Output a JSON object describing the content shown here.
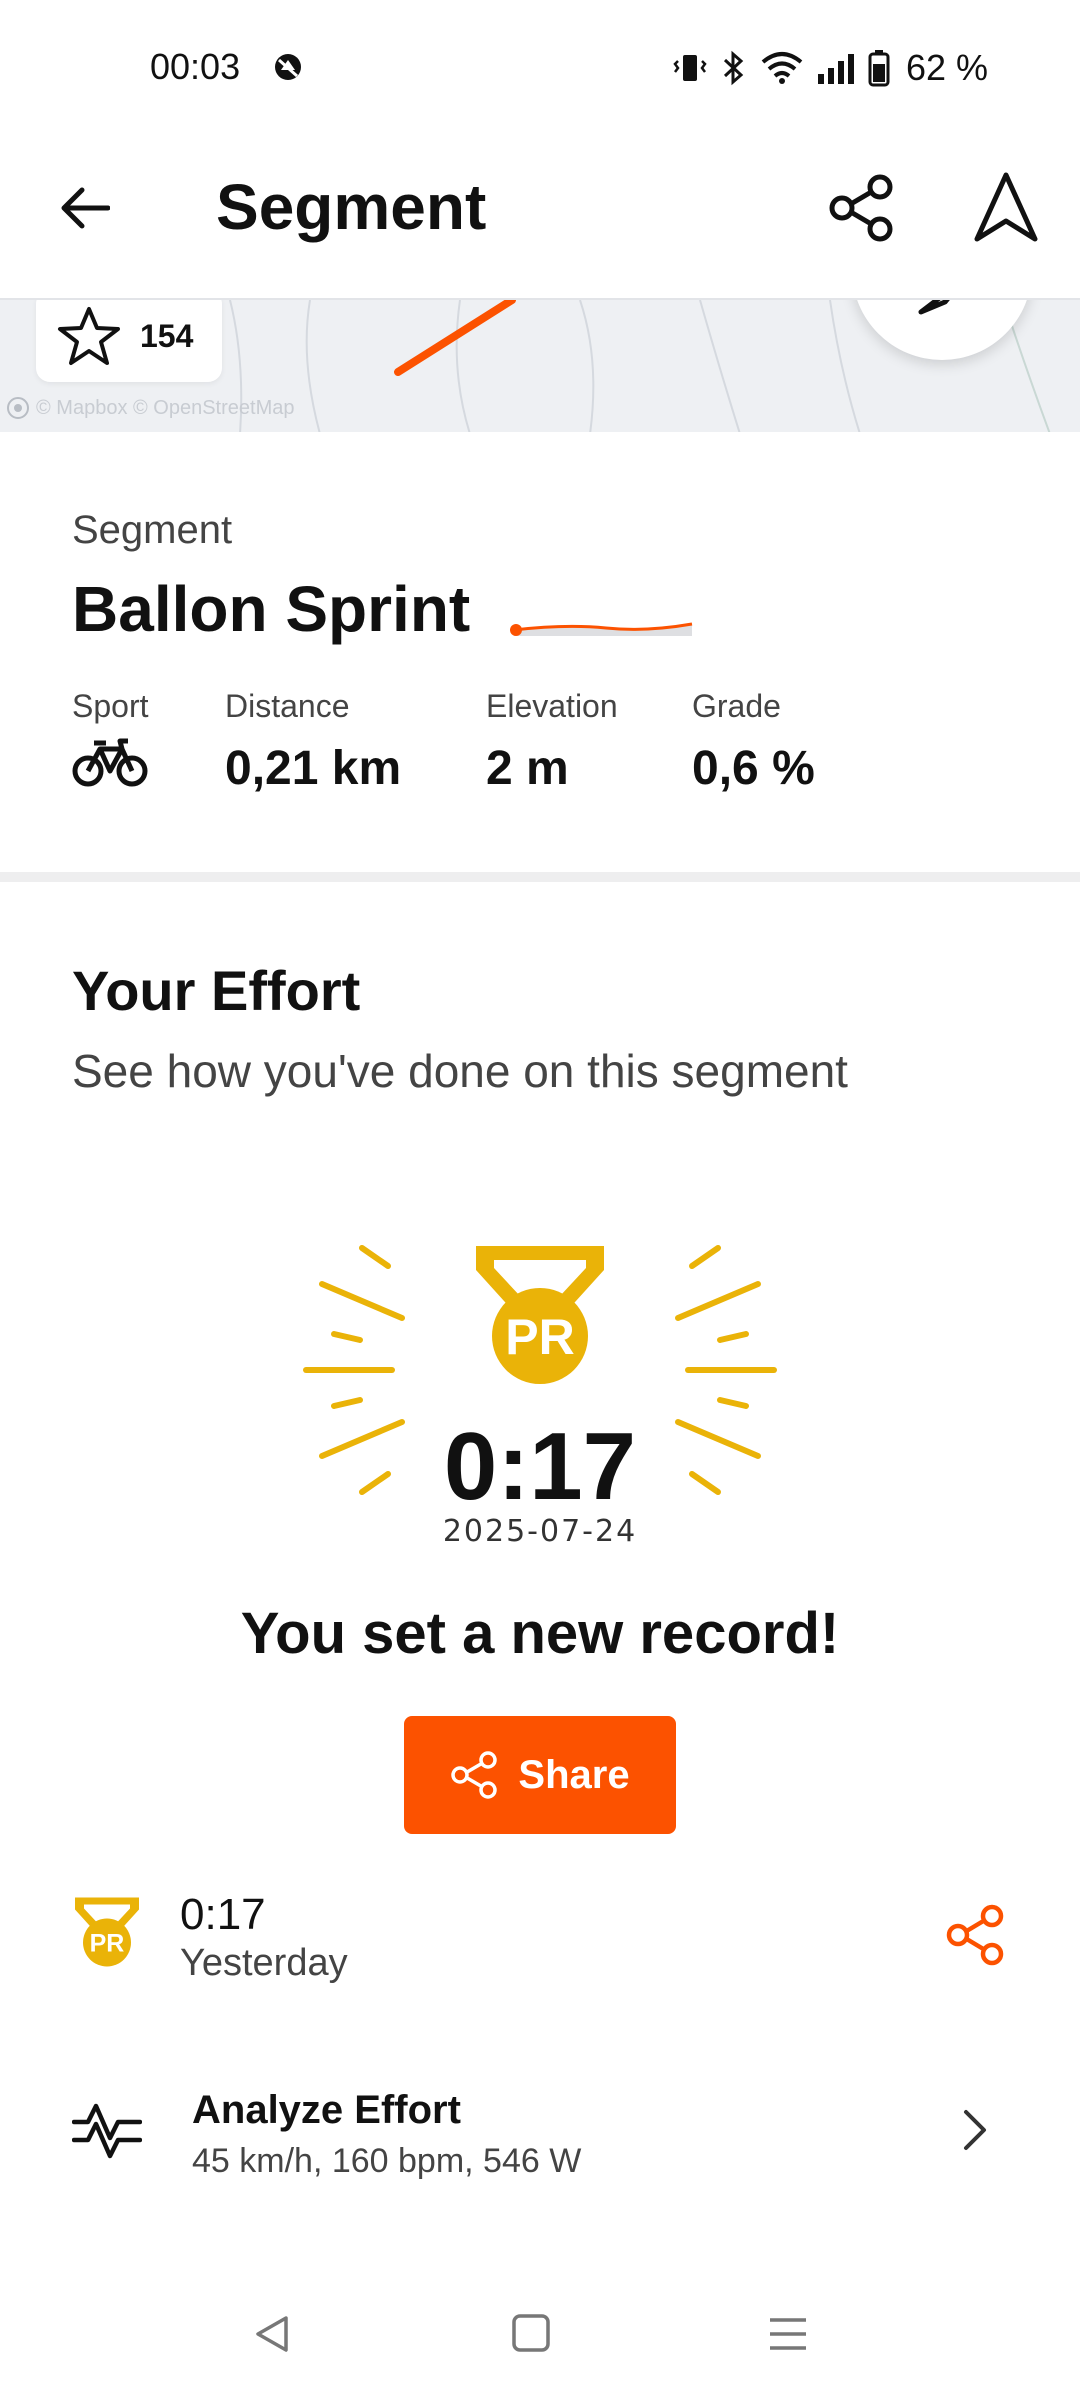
{
  "status_bar": {
    "time": "00:03",
    "battery": "62 %",
    "icons": [
      "dnd-icon",
      "vibrate-icon",
      "bluetooth-icon",
      "wifi-icon",
      "signal-icon",
      "battery-icon"
    ]
  },
  "header": {
    "title": "Segment",
    "icons": [
      "back-arrow-icon",
      "share-icon",
      "navigate-icon"
    ]
  },
  "map": {
    "star_count": "154",
    "attribution": "© Mapbox © OpenStreetMap",
    "route_color": "#fc5200"
  },
  "segment": {
    "label": "Segment",
    "name": "Ballon Sprint",
    "stats": [
      {
        "label": "Sport",
        "icon": "bike-icon"
      },
      {
        "label": "Distance",
        "value": "0,21 km"
      },
      {
        "label": "Elevation",
        "value": "2 m"
      },
      {
        "label": "Grade",
        "value": "0,6 %"
      }
    ]
  },
  "effort": {
    "title": "Your Effort",
    "subtitle": "See how you've done on this segment",
    "pr_badge": "PR",
    "pr_time": "0:17",
    "pr_date": "2025-07-24",
    "record_message": "You set a new record!",
    "share_label": "Share",
    "row": {
      "badge": "PR",
      "time": "0:17",
      "when": "Yesterday"
    },
    "analyze": {
      "title": "Analyze Effort",
      "subtitle": "45 km/h, 160 bpm, 546 W"
    }
  },
  "colors": {
    "accent": "#fc5200",
    "gold": "#eab308",
    "text": "#111111",
    "muted": "#444444"
  },
  "navbar": {
    "icons": [
      "nav-back-icon",
      "nav-home-icon",
      "nav-recents-icon"
    ]
  }
}
